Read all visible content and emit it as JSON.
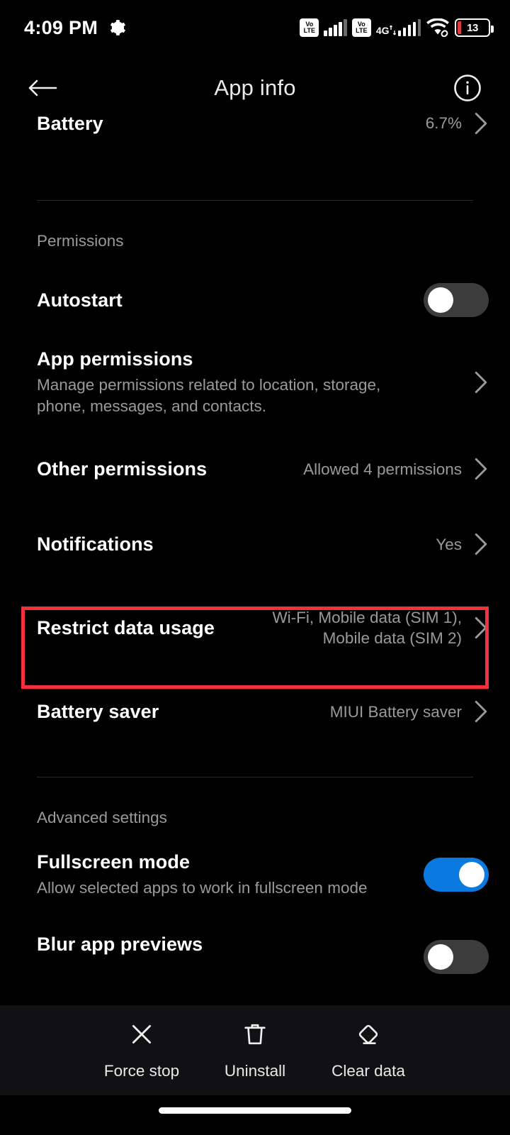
{
  "statusbar": {
    "time": "4:09 PM",
    "gear_icon": "gear-icon",
    "sim1_volte_top": "Vo",
    "sim1_volte_bottom": "LTE",
    "sim2_volte_top": "Vo",
    "sim2_volte_bottom": "LTE",
    "network_type": "4G",
    "wifi_icon": "wifi-icon",
    "battery_level": "13",
    "battery_color": "#e23b3b"
  },
  "appbar": {
    "back_icon": "back-arrow-icon",
    "title": "App info",
    "info_icon": "info-icon"
  },
  "battery_row": {
    "title": "Battery",
    "value": "6.7%"
  },
  "permissions_section": {
    "header": "Permissions",
    "autostart": {
      "title": "Autostart",
      "toggle": "off"
    },
    "app_permissions": {
      "title": "App permissions",
      "subtitle": "Manage permissions related to location, storage, phone, messages, and contacts."
    },
    "other_permissions": {
      "title": "Other permissions",
      "value": "Allowed 4 permissions"
    },
    "notifications": {
      "title": "Notifications",
      "value": "Yes"
    },
    "restrict_data_usage": {
      "title": "Restrict data usage",
      "value": "Wi-Fi, Mobile data (SIM 1), Mobile data (SIM 2)",
      "highlight_color": "#f5303c"
    },
    "battery_saver": {
      "title": "Battery saver",
      "value": "MIUI Battery saver"
    }
  },
  "advanced_section": {
    "header": "Advanced settings",
    "fullscreen_mode": {
      "title": "Fullscreen mode",
      "subtitle": "Allow selected apps to work in fullscreen mode",
      "toggle": "on",
      "toggle_color": "#0a7ae0"
    },
    "blur_app_previews": {
      "title": "Blur app previews",
      "toggle": "off"
    }
  },
  "actionbar": {
    "force_stop": {
      "label": "Force stop",
      "icon": "close-x-icon"
    },
    "uninstall": {
      "label": "Uninstall",
      "icon": "trash-icon"
    },
    "clear_data": {
      "label": "Clear data",
      "icon": "eraser-icon"
    }
  }
}
